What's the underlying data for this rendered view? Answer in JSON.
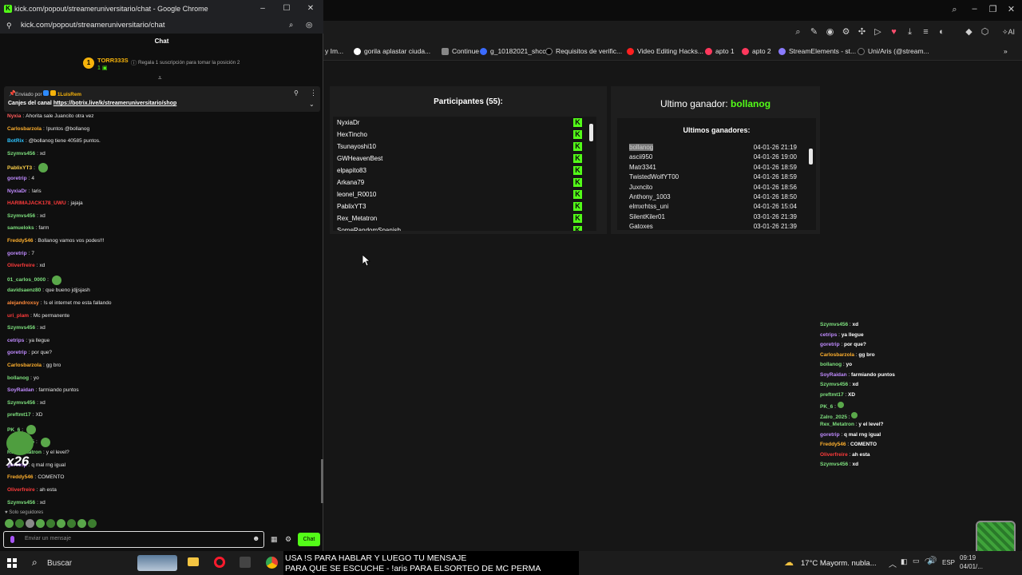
{
  "popup": {
    "window_title": "kick.com/popout/streameruniversitario/chat - Google Chrome",
    "url": "kick.com/popout/streameruniversitario/chat",
    "chat_header": "Chat",
    "leader_name": "TORR333S",
    "leader_count": "1",
    "leader_rank": "1",
    "leader_hint": "Regala 1 suscripción para tomar la posición 2",
    "pinned_sent_by": "Enviado por",
    "pinned_user": "1LuisRem",
    "pinned_text": "Canjes del canal",
    "pinned_link": "https://botrix.live/k/streameruniversitario/shop",
    "followers_only": "Solo seguidores",
    "input_placeholder": "Enviar un mensaje",
    "chat_button": "Chat",
    "overlay_badge": "x26",
    "messages": [
      {
        "user": "Nyxia",
        "color": "#ff5b5b",
        "text": "Ahorita sale Juancito otra vez"
      },
      {
        "user": "Carlosbarzola",
        "color": "#ffb02e",
        "text": "!puntos @bollanog"
      },
      {
        "user": "BotRix",
        "color": "#2ec4ff",
        "text": "@bollanog tiene 40585 puntos."
      },
      {
        "user": "Szymvs456",
        "color": "#7ee07e",
        "text": "xd"
      },
      {
        "user": "PablixYT3",
        "color": "#ffd24a",
        "text": ""
      },
      {
        "user": "goretrip",
        "color": "#c08bff",
        "text": "4"
      },
      {
        "user": "NyxiaDr",
        "color": "#c08bff",
        "text": "!aris"
      },
      {
        "user": "HARIMAJACK178_UWU",
        "color": "#ff3b3b",
        "text": "jajaja"
      },
      {
        "user": "Szymvs456",
        "color": "#7ee07e",
        "text": "xd"
      },
      {
        "user": "samueloks",
        "color": "#7ee07e",
        "text": "farm"
      },
      {
        "user": "Freddy546",
        "color": "#ffb02e",
        "text": "Bollanog vamos vos podes!!!"
      },
      {
        "user": "goretrip",
        "color": "#c08bff",
        "text": "7"
      },
      {
        "user": "Oliverfreire",
        "color": "#ff3b3b",
        "text": "xd"
      },
      {
        "user": "01_carlos_0000",
        "color": "#7ee07e",
        "text": ""
      },
      {
        "user": "davidsaenz80",
        "color": "#7ee07e",
        "text": "que bueno jdjjsjash"
      },
      {
        "user": "alejandroxsy",
        "color": "#ff8a3b",
        "text": "!s el internet me esta fallando"
      },
      {
        "user": "uri_plam",
        "color": "#ff3b3b",
        "text": "Mc permanente"
      },
      {
        "user": "Szymvs456",
        "color": "#7ee07e",
        "text": "xd"
      },
      {
        "user": "cetrips",
        "color": "#c08bff",
        "text": "ya llegue"
      },
      {
        "user": "goretrip",
        "color": "#c08bff",
        "text": "por que?"
      },
      {
        "user": "Carlosbarzola",
        "color": "#ffb02e",
        "text": "gg bro"
      },
      {
        "user": "bollanog",
        "color": "#7ee07e",
        "text": "yo"
      },
      {
        "user": "SoyRaidan",
        "color": "#c08bff",
        "text": "farmiando puntos"
      },
      {
        "user": "Szymvs456",
        "color": "#7ee07e",
        "text": "xd"
      },
      {
        "user": "preftmt17",
        "color": "#7ee07e",
        "text": "XD"
      },
      {
        "user": "PK_6",
        "color": "#7ee07e",
        "text": ""
      },
      {
        "user": "Zalro_2025",
        "color": "#7ee07e",
        "text": ""
      },
      {
        "user": "Rex_Metatron",
        "color": "#7ee07e",
        "text": "y el level?"
      },
      {
        "user": "goretrip",
        "color": "#c08bff",
        "text": "q mal rng igual"
      },
      {
        "user": "Freddy546",
        "color": "#ffb02e",
        "text": "COMENTO"
      },
      {
        "user": "Oliverfreire",
        "color": "#ff3b3b",
        "text": "ah esta"
      },
      {
        "user": "Szymvs456",
        "color": "#7ee07e",
        "text": "xd"
      }
    ]
  },
  "bookmarks": [
    "y Im...",
    "gorila aplastar ciuda...",
    "Continue",
    "g_10182021_shcc",
    "Requisitos de verific...",
    "Video Editing Hacks...",
    "apto 1",
    "apto 2",
    "StreamElements - st...",
    "Uni/Aris (@stream..."
  ],
  "participants": {
    "title": "Participantes",
    "count": "(55):",
    "names": [
      "NyxiaDr",
      "HexTincho",
      "Tsunayoshi10",
      "GWHeavenBest",
      "elpapito83",
      "Arkana79",
      "leonel_R0010",
      "PablixYT3",
      "Rex_Metatron",
      "SomeRandomSpanish"
    ]
  },
  "winners": {
    "title_prefix": "Ultimo ganador:",
    "last_winner": "bollanog",
    "subtitle": "Ultimos ganadores:",
    "rows": [
      {
        "name": "bollanog",
        "date": "04-01-26 21:19"
      },
      {
        "name": "ascii950",
        "date": "04-01-26 19:00"
      },
      {
        "name": "Matr3341",
        "date": "04-01-26 18:59"
      },
      {
        "name": "TwistedWolfYT00",
        "date": "04-01-26 18:59"
      },
      {
        "name": "Juxncito",
        "date": "04-01-26 18:56"
      },
      {
        "name": "Anthony_1003",
        "date": "04-01-26 18:50"
      },
      {
        "name": "elmxrhtss_uni",
        "date": "04-01-26 15:04"
      },
      {
        "name": "SilentKiler01",
        "date": "03-01-26 21:39"
      },
      {
        "name": "Gatoxes",
        "date": "03-01-26 21:39"
      }
    ]
  },
  "overlay_chat": [
    {
      "user": "Szymvs456",
      "color": "#7ee07e",
      "text": "xd"
    },
    {
      "user": "cetrips",
      "color": "#c08bff",
      "text": "ya llegue"
    },
    {
      "user": "goretrip",
      "color": "#c08bff",
      "text": "por que?"
    },
    {
      "user": "Carlosbarzola",
      "color": "#ffb02e",
      "text": "gg bro"
    },
    {
      "user": "bollanog",
      "color": "#7ee07e",
      "text": "yo"
    },
    {
      "user": "SoyRaidan",
      "color": "#c08bff",
      "text": "farmiando puntos"
    },
    {
      "user": "Szymvs456",
      "color": "#7ee07e",
      "text": "xd"
    },
    {
      "user": "preftmt17",
      "color": "#7ee07e",
      "text": "XD"
    },
    {
      "user": "PK_6",
      "color": "#7ee07e",
      "text": ""
    },
    {
      "user": "Zalro_2025",
      "color": "#7ee07e",
      "text": ""
    },
    {
      "user": "Rex_Metatron",
      "color": "#7ee07e",
      "text": "y el level?"
    },
    {
      "user": "goretrip",
      "color": "#c08bff",
      "text": "q mal rng igual"
    },
    {
      "user": "Freddy546",
      "color": "#ffb02e",
      "text": "COMENTO"
    },
    {
      "user": "Oliverfreire",
      "color": "#ff3b3b",
      "text": "ah esta"
    },
    {
      "user": "Szymvs456",
      "color": "#7ee07e",
      "text": "xd"
    }
  ],
  "subtitle_bar": {
    "line1": "USA !S PARA HABLAR Y LUEGO TU MENSAJE",
    "line2": "PARA QUE SE ESCUCHE - !aris PARA ELSORTEO DE MC PERMA"
  },
  "taskbar": {
    "search": "Buscar",
    "weather": "17°C Mayorm. nubla...",
    "lang": "ESP",
    "time": "09:19",
    "date": "04/01/..."
  },
  "colors": {
    "kick_green": "#53fc18"
  }
}
